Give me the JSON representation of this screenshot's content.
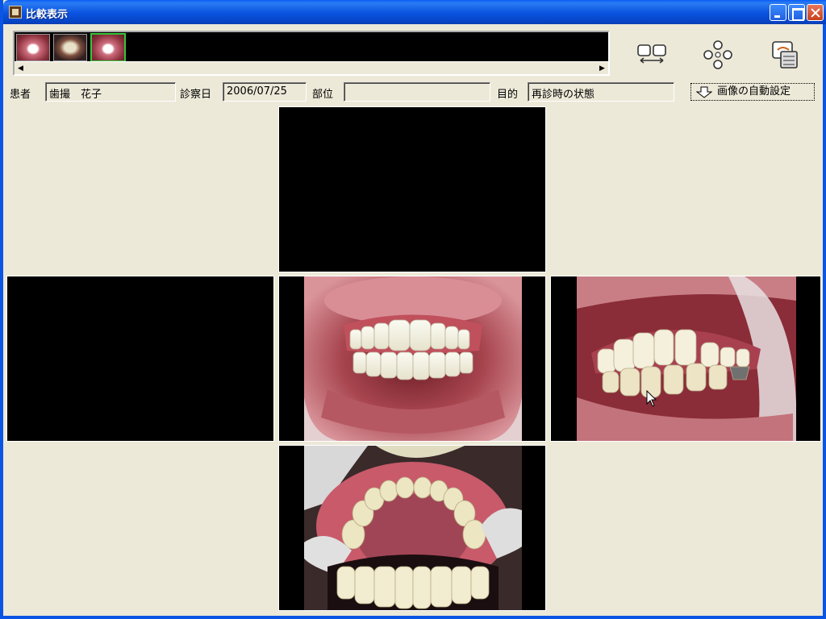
{
  "window": {
    "title": "比較表示"
  },
  "thumbnails": [
    {
      "name": "thumbnail-1",
      "selected": false
    },
    {
      "name": "thumbnail-2",
      "selected": false
    },
    {
      "name": "thumbnail-3",
      "selected": true
    }
  ],
  "toolbar": {
    "icons": [
      "compare-views-icon",
      "cross-layout-icon",
      "export-icon"
    ]
  },
  "patient": {
    "label": "患者",
    "value": "歯撮　花子"
  },
  "exam_date": {
    "label": "診察日",
    "value": "2006/07/25"
  },
  "region": {
    "label": "部位",
    "value": ""
  },
  "purpose": {
    "label": "目的",
    "value": "再診時の状態"
  },
  "auto_button": {
    "label": "画像の自動設定"
  },
  "colors": {
    "titlebar": "#0a55e4",
    "selection": "#36c43a",
    "background": "#ece9d8"
  }
}
